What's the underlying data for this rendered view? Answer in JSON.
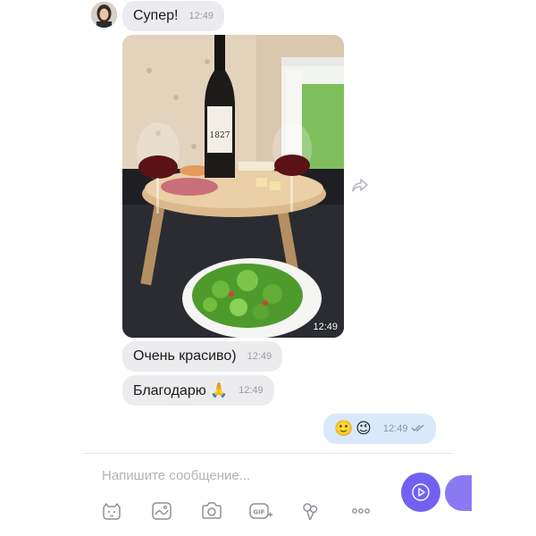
{
  "messages": {
    "incoming_1": {
      "text": "Супер!",
      "time": "12:49"
    },
    "photo": {
      "time": "12:49",
      "bottle_label_year": "1827"
    },
    "incoming_2": {
      "text": "Очень красиво)",
      "time": "12:49"
    },
    "incoming_3": {
      "text": "Благодарю 🙏",
      "time": "12:49"
    },
    "outgoing_1": {
      "emojis": [
        "🙂",
        "😉"
      ],
      "time": "12:49",
      "status": "read"
    }
  },
  "composer": {
    "placeholder": "Напишите сообщение..."
  },
  "toolbar": {
    "items": [
      "sticker-icon",
      "doodle-icon",
      "camera-icon",
      "gif-icon",
      "flowers-icon",
      "more-icon"
    ]
  },
  "colors": {
    "accent": "#7360f2",
    "incoming_bubble": "#ececef",
    "outgoing_bubble": "#d9e9fb"
  }
}
